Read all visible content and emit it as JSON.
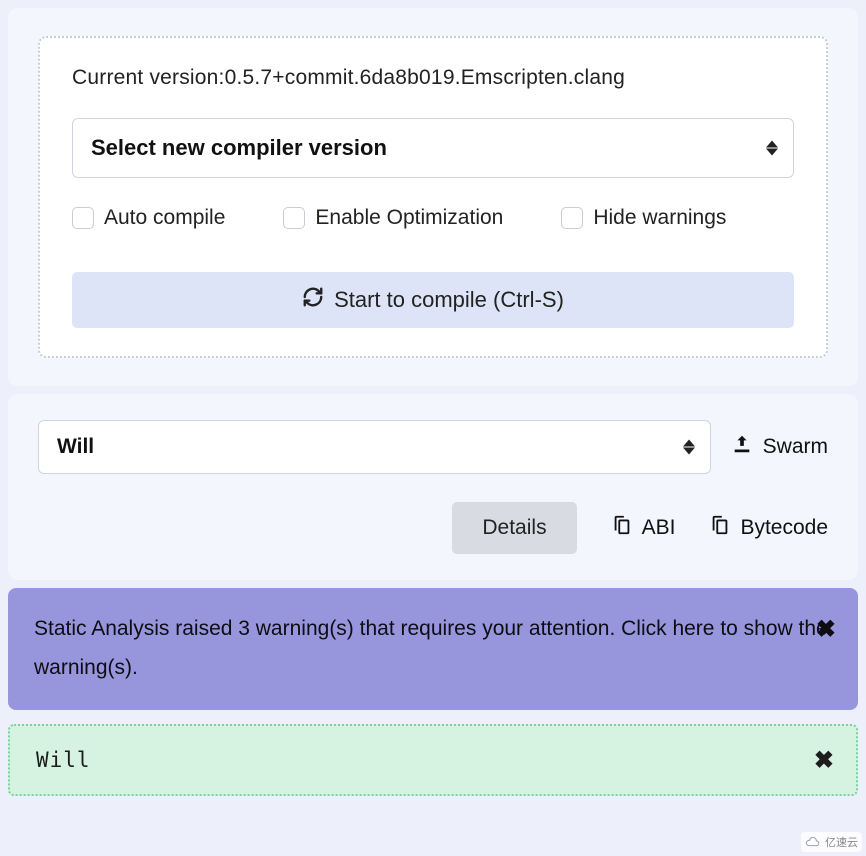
{
  "compile": {
    "version_label": "Current version:0.5.7+commit.6da8b019.Emscripten.clang",
    "compiler_placeholder": "Select new compiler version",
    "auto_compile": "Auto compile",
    "enable_optimization": "Enable Optimization",
    "hide_warnings": "Hide warnings",
    "start_compile": "Start to compile (Ctrl-S)"
  },
  "contract": {
    "selected": "Will",
    "swarm": "Swarm",
    "details": "Details",
    "abi": "ABI",
    "bytecode": "Bytecode"
  },
  "alerts": {
    "static_analysis": "Static Analysis raised 3 warning(s) that requires your attention. Click here to show the warning(s).",
    "success": "Will"
  },
  "watermark": "亿速云"
}
